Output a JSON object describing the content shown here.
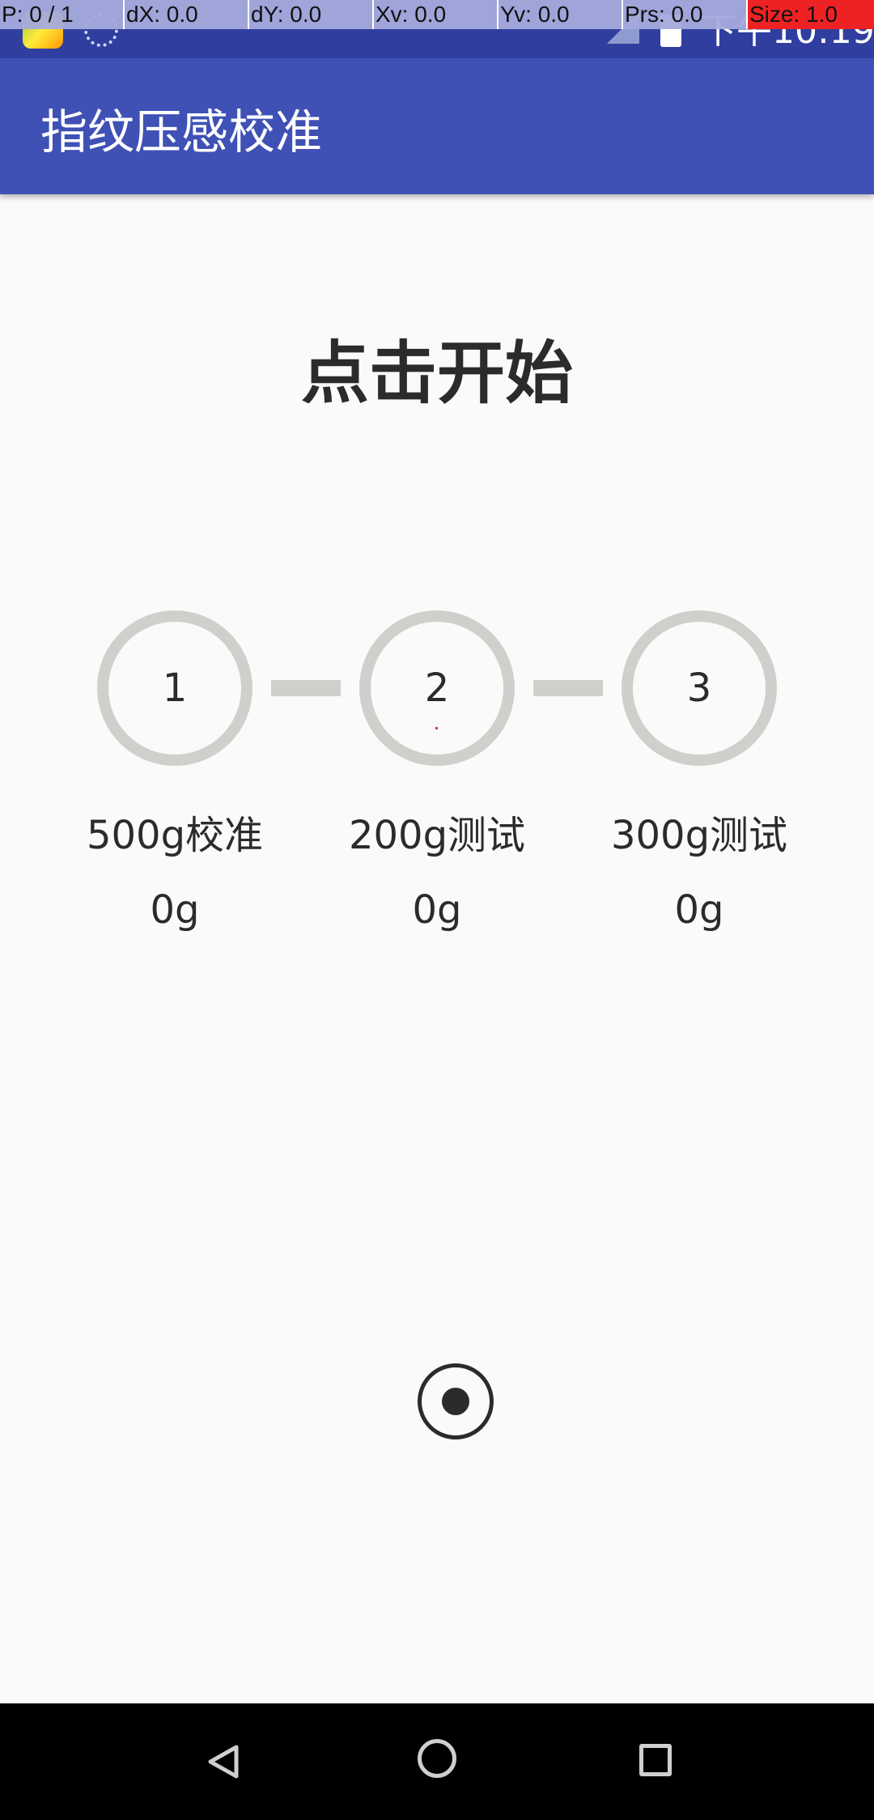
{
  "status_bar": {
    "time": "下午10:19",
    "icons": [
      "app-icon",
      "sync-icon",
      "no-signal-icon",
      "battery-icon"
    ]
  },
  "debug_overlay": {
    "cells": [
      {
        "text": "P: 0 / 1"
      },
      {
        "text": "dX: 0.0"
      },
      {
        "text": "dY: 0.0"
      },
      {
        "text": "Xv: 0.0"
      },
      {
        "text": "Yv: 0.0"
      },
      {
        "text": "Prs: 0.0"
      },
      {
        "text": "Size: 1.0"
      }
    ]
  },
  "app_bar": {
    "title": "指纹压感校准"
  },
  "main": {
    "heading": "点击开始",
    "steps": [
      {
        "number": "1",
        "label": "500g校准",
        "value": "0g"
      },
      {
        "number": "2",
        "label": "200g测试",
        "value": "0g"
      },
      {
        "number": "3",
        "label": "300g测试",
        "value": "0g"
      }
    ],
    "start_button_icon": "radio-button-checked-icon"
  },
  "nav_bar": {
    "icons": [
      "back-icon",
      "home-icon",
      "recents-icon"
    ]
  },
  "colors": {
    "status_bar": "#303f9f",
    "app_bar": "#3f51b5",
    "step_ring": "#d1cfcb",
    "text": "#2b2b2b",
    "background": "#fafafa"
  }
}
